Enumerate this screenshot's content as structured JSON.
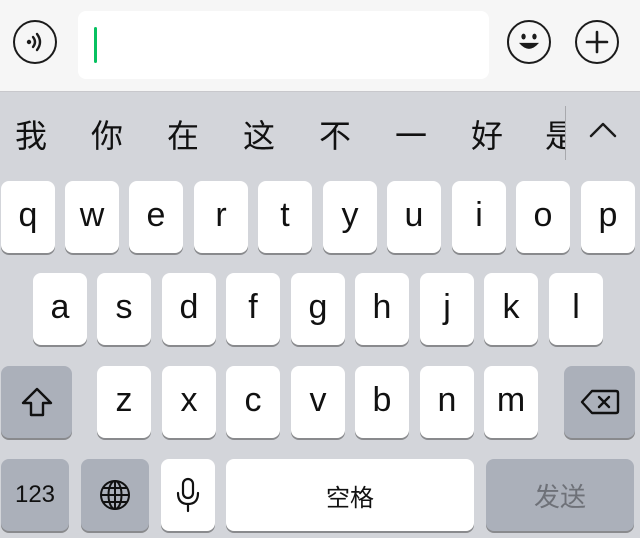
{
  "input_bar": {
    "voice_icon": "voice-wave-icon",
    "emoji_icon": "smiley-icon",
    "plus_icon": "plus-icon",
    "text_value": ""
  },
  "candidates": [
    "我",
    "你",
    "在",
    "这",
    "不",
    "一",
    "好",
    "是"
  ],
  "candidate_expand_icon": "chevron-up-icon",
  "keyboard": {
    "row1": [
      "q",
      "w",
      "e",
      "r",
      "t",
      "y",
      "u",
      "i",
      "o",
      "p"
    ],
    "row2": [
      "a",
      "s",
      "d",
      "f",
      "g",
      "h",
      "j",
      "k",
      "l"
    ],
    "row3": [
      "z",
      "x",
      "c",
      "v",
      "b",
      "n",
      "m"
    ],
    "shift_icon": "shift-arrow-icon",
    "delete_icon": "backspace-icon",
    "numbers_label": "123",
    "globe_icon": "globe-icon",
    "mic_icon": "microphone-icon",
    "space_label": "空格",
    "send_label": "发送"
  },
  "colors": {
    "keyboard_bg": "#d3d5da",
    "key_bg": "#ffffff",
    "function_key_bg": "#abb0ba",
    "caret": "#07c160"
  }
}
